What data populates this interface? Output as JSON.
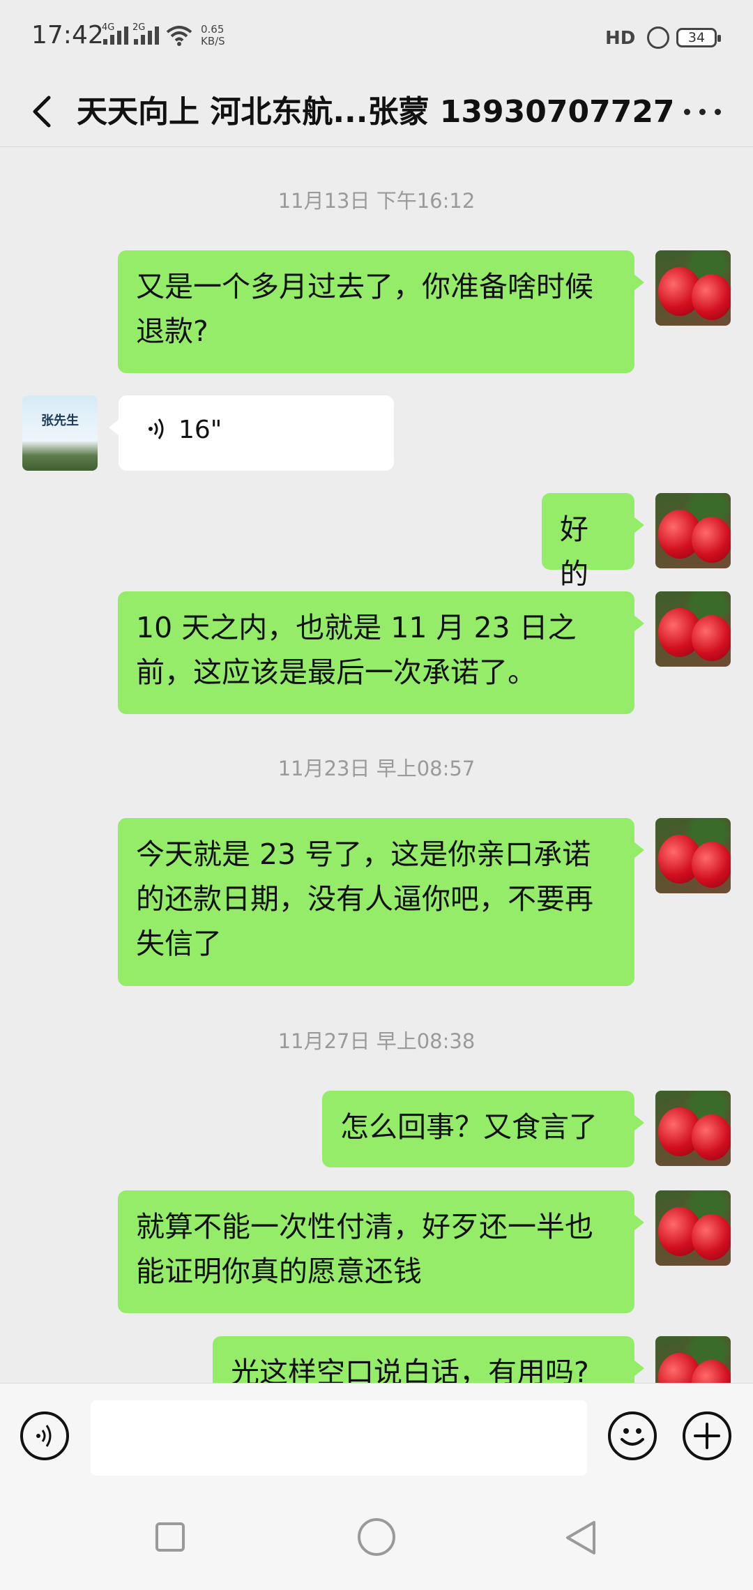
{
  "status_bar": {
    "time": "17:42",
    "signal1_label": "4G",
    "signal2_label": "2G",
    "net_speed_value": "0.65",
    "net_speed_unit": "KB/S",
    "hd_label": "HD",
    "battery": "34"
  },
  "header": {
    "title": "天天向上 河北东航...张蒙 13930707727",
    "back_icon": "chevron-left-icon",
    "more_icon": "more-dots-icon"
  },
  "chat": {
    "timestamps": [
      "11月13日 下午16:12",
      "11月23日 早上08:57",
      "11月27日 早上08:38"
    ],
    "messages": [
      {
        "side": "right",
        "text": "又是一个多月过去了，你准备啥时候退款?"
      },
      {
        "side": "left",
        "type": "voice",
        "duration": "16\"",
        "avatar_text": "张先生"
      },
      {
        "side": "right",
        "text": "好的"
      },
      {
        "side": "right",
        "text": "10 天之内，也就是 11 月 23 日之前，这应该是最后一次承诺了。"
      },
      {
        "side": "right",
        "text": "今天就是 23 号了，这是你亲口承诺的还款日期，没有人逼你吧，不要再失信了"
      },
      {
        "side": "right",
        "text": "怎么回事？又食言了"
      },
      {
        "side": "right",
        "text": "就算不能一次性付清，好歹还一半也能证明你真的愿意还钱"
      },
      {
        "side": "right",
        "text": "光这样空口说白话，有用吗?"
      }
    ]
  },
  "input_bar": {
    "voice_icon": "voice-input-icon",
    "emoji_icon": "emoji-icon",
    "plus_icon": "plus-icon"
  },
  "nav_bar": {
    "recent_icon": "square-icon",
    "home_icon": "circle-icon",
    "back_icon": "triangle-back-icon"
  }
}
